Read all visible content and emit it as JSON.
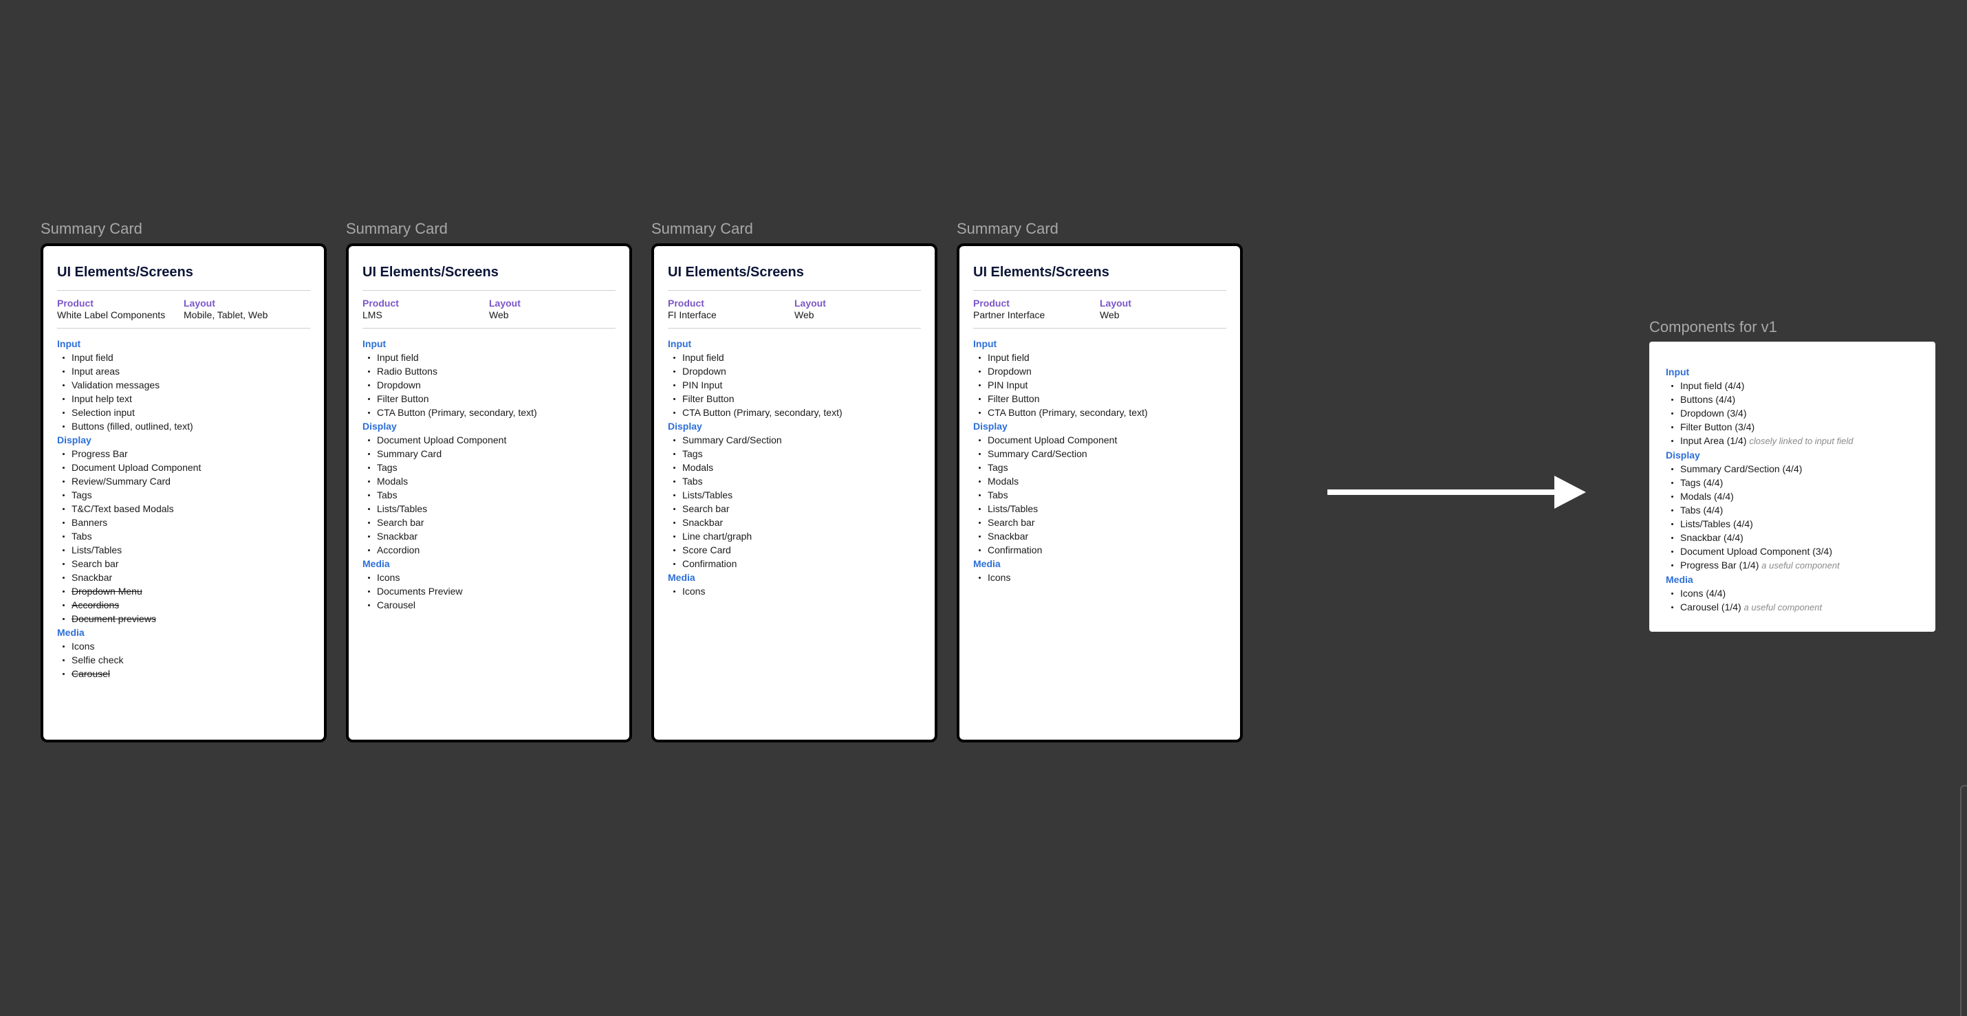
{
  "cards": [
    {
      "frame_label": "Summary Card",
      "heading": "UI Elements/Screens",
      "product_label": "Product",
      "product": "White Label Components",
      "layout_label": "Layout",
      "layout": "Mobile, Tablet, Web",
      "sections": [
        {
          "title": "Input",
          "items": [
            {
              "text": "Input field"
            },
            {
              "text": "Input areas"
            },
            {
              "text": "Validation messages"
            },
            {
              "text": "Input help text"
            },
            {
              "text": "Selection input"
            },
            {
              "text": "Buttons (filled, outlined, text)"
            }
          ]
        },
        {
          "title": "Display",
          "items": [
            {
              "text": "Progress Bar"
            },
            {
              "text": "Document Upload Component"
            },
            {
              "text": "Review/Summary Card"
            },
            {
              "text": "Tags"
            },
            {
              "text": "T&C/Text based Modals"
            },
            {
              "text": "Banners"
            },
            {
              "text": "Tabs"
            },
            {
              "text": "Lists/Tables"
            },
            {
              "text": "Search bar"
            },
            {
              "text": "Snackbar"
            },
            {
              "text": "Dropdown Menu",
              "struck": true
            },
            {
              "text": "Accordions",
              "struck": true
            },
            {
              "text": "Document previews",
              "struck": true
            }
          ]
        },
        {
          "title": "Media",
          "items": [
            {
              "text": "Icons"
            },
            {
              "text": "Selfie check"
            },
            {
              "text": "Carousel",
              "struck": true
            }
          ]
        }
      ]
    },
    {
      "frame_label": "Summary Card",
      "heading": "UI Elements/Screens",
      "product_label": "Product",
      "product": "LMS",
      "layout_label": "Layout",
      "layout": "Web",
      "sections": [
        {
          "title": "Input",
          "items": [
            {
              "text": "Input field"
            },
            {
              "text": "Radio Buttons"
            },
            {
              "text": "Dropdown"
            },
            {
              "text": "Filter Button"
            },
            {
              "text": "CTA Button (Primary, secondary, text)"
            }
          ]
        },
        {
          "title": "Display",
          "items": [
            {
              "text": "Document Upload Component"
            },
            {
              "text": "Summary Card"
            },
            {
              "text": "Tags"
            },
            {
              "text": "Modals"
            },
            {
              "text": "Tabs"
            },
            {
              "text": "Lists/Tables"
            },
            {
              "text": "Search bar"
            },
            {
              "text": "Snackbar"
            },
            {
              "text": "Accordion"
            }
          ]
        },
        {
          "title": "Media",
          "items": [
            {
              "text": "Icons"
            },
            {
              "text": "Documents Preview"
            },
            {
              "text": "Carousel"
            }
          ]
        }
      ]
    },
    {
      "frame_label": "Summary Card",
      "heading": "UI Elements/Screens",
      "product_label": "Product",
      "product": "FI Interface",
      "layout_label": "Layout",
      "layout": "Web",
      "sections": [
        {
          "title": "Input",
          "items": [
            {
              "text": "Input field"
            },
            {
              "text": "Dropdown"
            },
            {
              "text": "PIN Input"
            },
            {
              "text": "Filter Button"
            },
            {
              "text": "CTA Button (Primary, secondary, text)"
            }
          ]
        },
        {
          "title": "Display",
          "items": [
            {
              "text": "Summary Card/Section"
            },
            {
              "text": "Tags"
            },
            {
              "text": "Modals"
            },
            {
              "text": "Tabs"
            },
            {
              "text": "Lists/Tables"
            },
            {
              "text": "Search bar"
            },
            {
              "text": "Snackbar"
            },
            {
              "text": "Line chart/graph"
            },
            {
              "text": "Score Card"
            },
            {
              "text": "Confirmation"
            }
          ]
        },
        {
          "title": "Media",
          "items": [
            {
              "text": "Icons"
            }
          ]
        }
      ]
    },
    {
      "frame_label": "Summary Card",
      "heading": "UI Elements/Screens",
      "product_label": "Product",
      "product": "Partner Interface",
      "layout_label": "Layout",
      "layout": "Web",
      "sections": [
        {
          "title": "Input",
          "items": [
            {
              "text": "Input field"
            },
            {
              "text": "Dropdown"
            },
            {
              "text": "PIN Input"
            },
            {
              "text": "Filter Button"
            },
            {
              "text": "CTA Button (Primary, secondary, text)"
            }
          ]
        },
        {
          "title": "Display",
          "items": [
            {
              "text": "Document Upload Component"
            },
            {
              "text": "Summary Card/Section"
            },
            {
              "text": "Tags"
            },
            {
              "text": "Modals"
            },
            {
              "text": "Tabs"
            },
            {
              "text": "Lists/Tables"
            },
            {
              "text": "Search bar"
            },
            {
              "text": "Snackbar"
            },
            {
              "text": "Confirmation"
            }
          ]
        },
        {
          "title": "Media",
          "items": [
            {
              "text": "Icons"
            }
          ]
        }
      ]
    }
  ],
  "arrow_icon": "right-arrow-icon",
  "components_v1": {
    "frame_label": "Components for v1",
    "sections": [
      {
        "title": "Input",
        "items": [
          {
            "text": "Input field (4/4)"
          },
          {
            "text": "Buttons (4/4)"
          },
          {
            "text": "Dropdown (3/4)"
          },
          {
            "text": "Filter Button (3/4)"
          },
          {
            "text": "Input Area (1/4)",
            "note": "closely linked to input field"
          }
        ]
      },
      {
        "title": "Display",
        "items": [
          {
            "text": "Summary Card/Section (4/4)"
          },
          {
            "text": "Tags (4/4)"
          },
          {
            "text": "Modals (4/4)"
          },
          {
            "text": "Tabs (4/4)"
          },
          {
            "text": "Lists/Tables (4/4)"
          },
          {
            "text": "Snackbar (4/4)"
          },
          {
            "text": "Document Upload Component (3/4)"
          },
          {
            "text": "Progress Bar (1/4)",
            "note": "a useful component"
          }
        ]
      },
      {
        "title": "Media",
        "items": [
          {
            "text": "Icons (4/4)"
          },
          {
            "text": "Carousel (1/4)",
            "note": "a useful component"
          }
        ]
      }
    ]
  },
  "colors": {
    "canvas": "#383838",
    "section_title": "#2d6fd8",
    "meta_label": "#7b56c8",
    "heading": "#0c1537"
  }
}
